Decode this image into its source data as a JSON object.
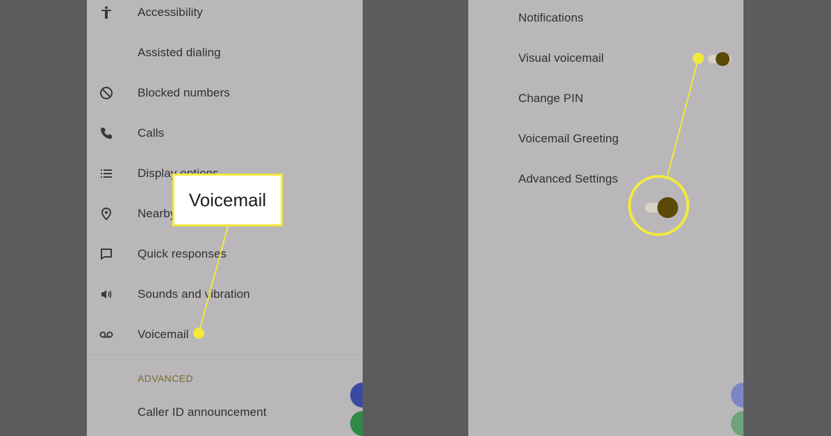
{
  "settings_list": {
    "items": [
      {
        "label": "Accessibility",
        "icon": "accessibility-icon"
      },
      {
        "label": "Assisted dialing",
        "icon": ""
      },
      {
        "label": "Blocked numbers",
        "icon": "block-icon"
      },
      {
        "label": "Calls",
        "icon": "phone-icon"
      },
      {
        "label": "Display options",
        "icon": "list-icon"
      },
      {
        "label": "Nearby places",
        "icon": "location-pin-icon"
      },
      {
        "label": "Quick responses",
        "icon": "message-icon"
      },
      {
        "label": "Sounds and vibration",
        "icon": "speaker-icon"
      },
      {
        "label": "Voicemail",
        "icon": "voicemail-icon"
      }
    ],
    "advanced_header": "ADVANCED",
    "advanced_items": [
      {
        "label": "Caller ID announcement"
      }
    ]
  },
  "voicemail_settings": {
    "items": [
      {
        "label": "Notifications"
      },
      {
        "label": "Visual voicemail"
      },
      {
        "label": "Change PIN"
      },
      {
        "label": "Voicemail Greeting"
      },
      {
        "label": "Advanced Settings"
      }
    ],
    "visual_voicemail_toggle": "on"
  },
  "callout": {
    "label": "Voicemail"
  },
  "colors": {
    "highlight": "#f3ea3e",
    "toggle_on": "#5a4a06",
    "section_header": "#7a6a2e",
    "fab_blue": "#3b4aa0",
    "fab_green": "#2f8a45"
  }
}
